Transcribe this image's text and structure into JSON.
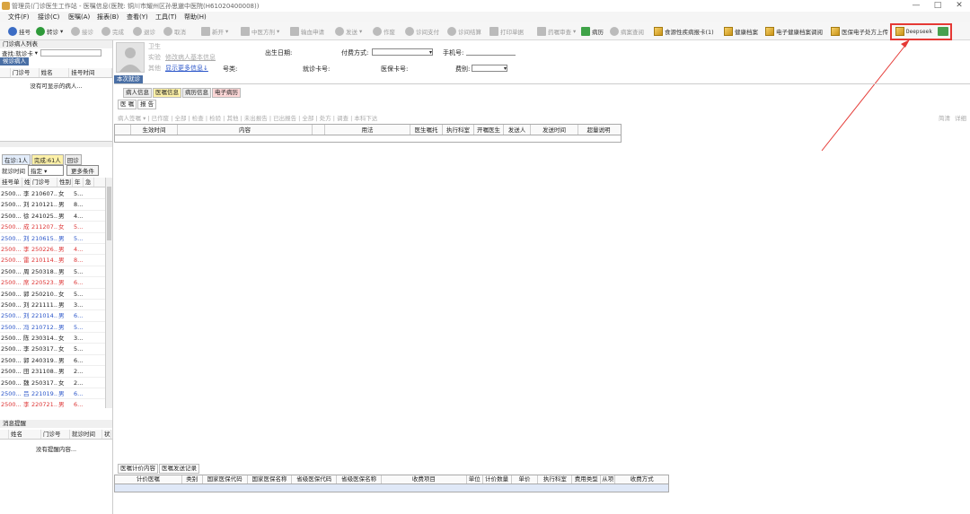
{
  "window": {
    "title": "管理员(门诊医生工作站 - 医嘱信息(医院: 铜川市耀州区孙思邈中医院(H61020400008))",
    "controls": [
      "—",
      "□",
      "✕"
    ]
  },
  "menu": [
    "文件(F)",
    "接诊(C)",
    "医嘱(A)",
    "报表(B)",
    "查看(Y)",
    "工具(T)",
    "帮助(H)"
  ],
  "toolbar": {
    "items": [
      {
        "label": "挂号",
        "icon": "register-icon",
        "enabled": true
      },
      {
        "label": "转诊",
        "icon": "transfer-icon",
        "enabled": true
      },
      {
        "label": "接诊",
        "icon": "accept-icon",
        "enabled": false
      },
      {
        "label": "完成",
        "icon": "complete-icon",
        "enabled": false
      },
      {
        "label": "退诊",
        "icon": "return-icon",
        "enabled": false
      },
      {
        "label": "取消",
        "icon": "cancel-icon",
        "enabled": false
      },
      {
        "label": "新开",
        "icon": "new-icon",
        "enabled": false
      },
      {
        "label": "中医方剂",
        "icon": "tcm-recipe-icon",
        "enabled": false
      },
      {
        "label": "输血申请",
        "icon": "blood-icon",
        "enabled": false
      },
      {
        "label": "发送",
        "icon": "send-icon",
        "enabled": false
      },
      {
        "label": "作废",
        "icon": "void-icon",
        "enabled": false
      },
      {
        "label": "诊间支付",
        "icon": "pay-icon",
        "enabled": false
      },
      {
        "label": "诊间结算",
        "icon": "settle-icon",
        "enabled": false
      },
      {
        "label": "打印单据",
        "icon": "print-icon",
        "enabled": false
      },
      {
        "label": "药嘱审查",
        "icon": "review-icon",
        "enabled": false
      },
      {
        "label": "病历",
        "icon": "record-icon",
        "enabled": true
      },
      {
        "label": "病案查阅",
        "icon": "case-lookup-icon",
        "enabled": false
      },
      {
        "label": "食源性疾病报卡(1)",
        "icon": "box-icon",
        "enabled": true
      },
      {
        "label": "健康档案",
        "icon": "box-icon",
        "enabled": true
      },
      {
        "label": "电子健康档案调阅",
        "icon": "box-icon",
        "enabled": true
      },
      {
        "label": "医保电子处方上传",
        "icon": "box-icon",
        "enabled": true
      },
      {
        "label": "Deepseek",
        "icon": "box-icon",
        "enabled": true
      }
    ],
    "exit_icon": "exit-icon"
  },
  "left_panel": {
    "title": "门诊病人列表",
    "search_label": "查找:",
    "search_mode": "就诊卡",
    "tab_label": "候诊病人",
    "waiting_headers": [
      "门诊号",
      "姓名",
      "挂号时间"
    ],
    "waiting_empty": "没有可显示的病人...",
    "status_tabs": [
      "在诊:1人",
      "完成:61人",
      "回诊"
    ],
    "visit_time_label": "就诊时间",
    "visit_time_value": "指定",
    "more_button": "更多条件",
    "list_headers": [
      "挂号单",
      "姓",
      "门诊号",
      "性别",
      "年",
      "急"
    ],
    "rows": [
      {
        "a": "2500...",
        "b": "李",
        "c": "210607...",
        "d": "女",
        "e": "5...",
        "color": ""
      },
      {
        "a": "2500...",
        "b": "刘",
        "c": "210121...",
        "d": "男",
        "e": "8...",
        "color": ""
      },
      {
        "a": "2500...",
        "b": "徐",
        "c": "241025...",
        "d": "男",
        "e": "4...",
        "color": ""
      },
      {
        "a": "2500...",
        "b": "成",
        "c": "211207...",
        "d": "女",
        "e": "5...",
        "color": "red"
      },
      {
        "a": "2500...",
        "b": "刘",
        "c": "210615...",
        "d": "男",
        "e": "5...",
        "color": "blue"
      },
      {
        "a": "2500...",
        "b": "李",
        "c": "250226...",
        "d": "男",
        "e": "4...",
        "color": "red"
      },
      {
        "a": "2500...",
        "b": "雷",
        "c": "210114...",
        "d": "男",
        "e": "8...",
        "color": "red"
      },
      {
        "a": "2500...",
        "b": "周",
        "c": "250318...",
        "d": "男",
        "e": "5...",
        "color": ""
      },
      {
        "a": "2500...",
        "b": "席",
        "c": "220523...",
        "d": "男",
        "e": "6...",
        "color": "red"
      },
      {
        "a": "2500...",
        "b": "郭",
        "c": "250210...",
        "d": "女",
        "e": "5...",
        "color": ""
      },
      {
        "a": "2500...",
        "b": "刘",
        "c": "221111...",
        "d": "男",
        "e": "3...",
        "color": ""
      },
      {
        "a": "2500...",
        "b": "刘",
        "c": "221014...",
        "d": "男",
        "e": "6...",
        "color": "blue"
      },
      {
        "a": "2500...",
        "b": "冯",
        "c": "210712...",
        "d": "男",
        "e": "5...",
        "color": "blue"
      },
      {
        "a": "2500...",
        "b": "陈",
        "c": "230314...",
        "d": "女",
        "e": "3...",
        "color": ""
      },
      {
        "a": "2500...",
        "b": "李",
        "c": "250317...",
        "d": "女",
        "e": "5...",
        "color": ""
      },
      {
        "a": "2500...",
        "b": "郭",
        "c": "240319...",
        "d": "男",
        "e": "6...",
        "color": ""
      },
      {
        "a": "2500...",
        "b": "田",
        "c": "231108...",
        "d": "男",
        "e": "2...",
        "color": ""
      },
      {
        "a": "2500...",
        "b": "魏",
        "c": "250317...",
        "d": "女",
        "e": "2...",
        "color": ""
      },
      {
        "a": "2500...",
        "b": "吕",
        "c": "221019...",
        "d": "男",
        "e": "6...",
        "color": "blue"
      },
      {
        "a": "2500...",
        "b": "李",
        "c": "220721...",
        "d": "男",
        "e": "6...",
        "color": "red"
      }
    ],
    "messages_title": "消息提醒",
    "messages_headers": [
      "姓名",
      "门诊号",
      "就诊时间",
      "状"
    ],
    "messages_empty": "没有提醒内容..."
  },
  "patient": {
    "l1": "卫生",
    "l2": "实验",
    "l3": "其他",
    "basic_info": "修改病人基本信息",
    "more_info": "显示更多信息↓",
    "birth_label": "出生日期:",
    "pay_label": "付费方式:",
    "phone_label": "手机号:",
    "id_label": "号类:",
    "card_label": "就诊卡号:",
    "insure_label": "医保卡号:",
    "cat_label": "费别:"
  },
  "main": {
    "visit_tab": "本次就诊",
    "subtabs": [
      "病人信息",
      "医嘱信息",
      "病历信息",
      "电子病历"
    ],
    "inner_tabs": [
      "医 嘱",
      "报 告"
    ],
    "order_toolbar": "病人签嘱 ▾ | 已作废 | 全部 | 检查 | 检验 | 其他 | 未出报告 | 已出报告 | 全部 | 处方 | 调查 | 本科下达",
    "order_toolbar_right": [
      "简清",
      "详细"
    ],
    "order_headers": [
      "",
      "生效时间",
      "内容",
      "",
      "用法",
      "医生嘱托",
      "执行科室",
      "开嘱医生",
      "发送人",
      "发送时间",
      "超量说明"
    ],
    "bottom_tabs": [
      "医嘱计价内容",
      "医嘱发送记录"
    ],
    "fee_headers": [
      "计价医嘱",
      "类别",
      "国家医保代码",
      "国家医保名称",
      "省级医保代码",
      "省级医保名称",
      "收费项目",
      "单位",
      "计价数量",
      "单价",
      "执行科室",
      "费用类型",
      "从项",
      "收费方式"
    ]
  },
  "colors": {
    "highlight": "#e53935",
    "arrow": "#e53935",
    "accent": "#4a6fa5"
  }
}
